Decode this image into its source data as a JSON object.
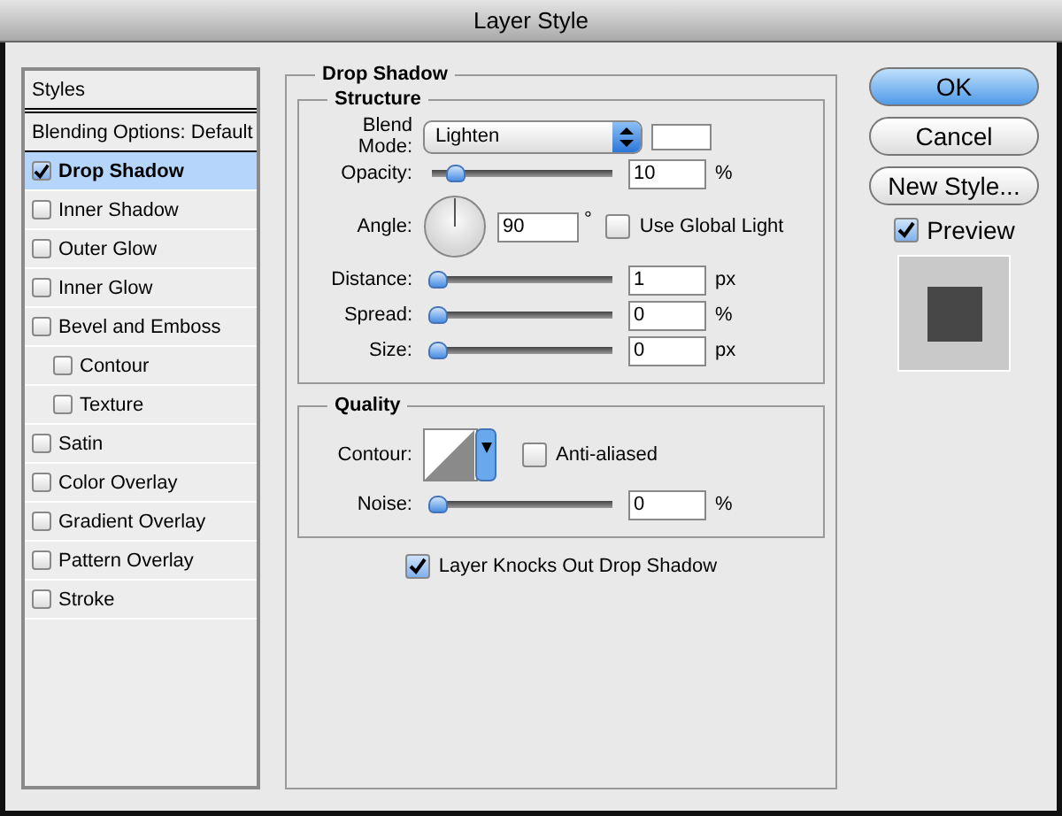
{
  "window": {
    "title": "Layer Style"
  },
  "styles_list": {
    "header": "Styles",
    "items": [
      {
        "label": "Blending Options: Default",
        "kind": "plain",
        "selected": false
      },
      {
        "label": "Drop Shadow",
        "kind": "check",
        "checked": true,
        "selected": true
      },
      {
        "label": "Inner Shadow",
        "kind": "check",
        "checked": false,
        "selected": false
      },
      {
        "label": "Outer Glow",
        "kind": "check",
        "checked": false,
        "selected": false
      },
      {
        "label": "Inner Glow",
        "kind": "check",
        "checked": false,
        "selected": false
      },
      {
        "label": "Bevel and Emboss",
        "kind": "check",
        "checked": false,
        "selected": false,
        "children": [
          {
            "label": "Contour",
            "kind": "check",
            "checked": false,
            "selected": false
          },
          {
            "label": "Texture",
            "kind": "check",
            "checked": false,
            "selected": false
          }
        ]
      },
      {
        "label": "Satin",
        "kind": "check",
        "checked": false,
        "selected": false
      },
      {
        "label": "Color Overlay",
        "kind": "check",
        "checked": false,
        "selected": false
      },
      {
        "label": "Gradient Overlay",
        "kind": "check",
        "checked": false,
        "selected": false
      },
      {
        "label": "Pattern Overlay",
        "kind": "check",
        "checked": false,
        "selected": false
      },
      {
        "label": "Stroke",
        "kind": "check",
        "checked": false,
        "selected": false
      }
    ]
  },
  "panel": {
    "title": "Drop Shadow",
    "structure": {
      "title": "Structure",
      "blend_mode": {
        "label": "Blend Mode:",
        "value": "Lighten",
        "color": "#ffffff"
      },
      "rows": [
        {
          "kind": "slider",
          "label": "Opacity:",
          "level": 0.1,
          "value": "10",
          "unit": "%"
        },
        {
          "kind": "angle",
          "label": "Angle:",
          "value": "90",
          "unit": "°",
          "global_light": {
            "label": "Use Global Light",
            "checked": false
          }
        },
        {
          "kind": "slider",
          "label": "Distance:",
          "level": 0,
          "value": "1",
          "unit": "px"
        },
        {
          "kind": "slider",
          "label": "Spread:",
          "level": 0,
          "value": "0",
          "unit": "%"
        },
        {
          "kind": "slider",
          "label": "Size:",
          "level": 0,
          "value": "0",
          "unit": "px"
        }
      ]
    },
    "quality": {
      "title": "Quality",
      "contour": {
        "label": "Contour:",
        "anti_aliased": {
          "label": "Anti-aliased",
          "checked": false
        }
      },
      "noise": {
        "label": "Noise:",
        "level": 0,
        "value": "0",
        "unit": "%"
      }
    },
    "knockout": {
      "label": "Layer Knocks Out Drop Shadow",
      "checked": true
    }
  },
  "buttons": [
    {
      "label": "OK",
      "default": true
    },
    {
      "label": "Cancel",
      "default": false
    },
    {
      "label": "New Style...",
      "default": false
    }
  ],
  "preview": {
    "label": "Preview",
    "checked": true
  }
}
